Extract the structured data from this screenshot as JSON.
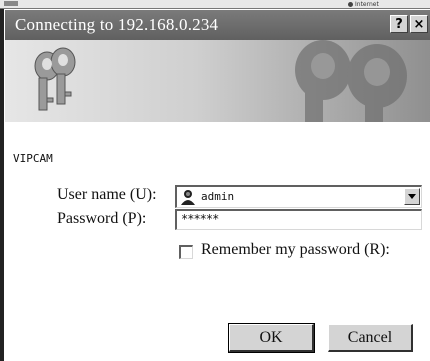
{
  "statusbar": {
    "zone_label": "Internet"
  },
  "dialog": {
    "title": "Connecting to 192.168.0.234",
    "help_button": "?",
    "close_button": "×",
    "realm": "VIPCAM",
    "username_label": "User name (U):",
    "username_value": "admin",
    "password_label": "Password (P):",
    "password_value": "******",
    "remember_label": "Remember my password (R):",
    "remember_checked": false,
    "ok_label": "OK",
    "cancel_label": "Cancel"
  },
  "icons": {
    "banner": "keys-icon",
    "user": "user-icon",
    "dropdown": "chevron-down-icon",
    "zone": "globe-icon"
  }
}
